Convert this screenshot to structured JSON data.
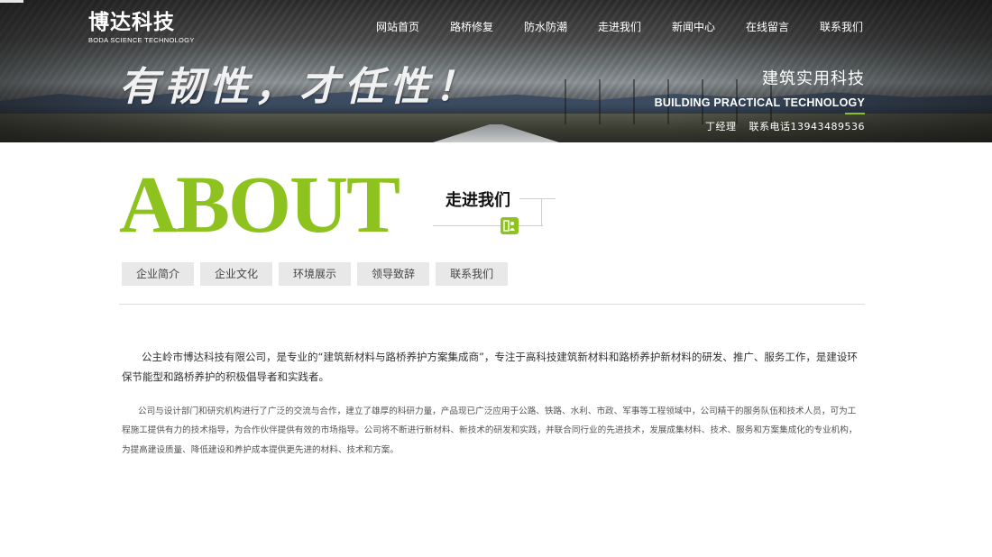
{
  "header": {
    "logo_cn": "博达科技",
    "logo_en": "BODA SCIENCE TECHNOLOGY",
    "nav": [
      {
        "label": "网站首页"
      },
      {
        "label": "路桥修复"
      },
      {
        "label": "防水防潮"
      },
      {
        "label": "走进我们"
      },
      {
        "label": "新闻中心"
      },
      {
        "label": "在线留言"
      },
      {
        "label": "联系我们"
      }
    ],
    "slogan": "有韧性，才任性！",
    "tagline_cn": "建筑实用科技",
    "tagline_en": "BUILDING PRACTICAL TECHNOLOGY",
    "contact_person": "丁经理",
    "contact_phone": "联系电话13943489536"
  },
  "about": {
    "big_title": "ABOUT",
    "cn_title": "走进我们",
    "tabs": [
      {
        "label": "企业简介"
      },
      {
        "label": "企业文化"
      },
      {
        "label": "环境展示"
      },
      {
        "label": "领导致辞"
      },
      {
        "label": "联系我们"
      }
    ],
    "para1": "公主岭市博达科技有限公司，是专业的“建筑新材料与路桥养护方案集成商”，专注于高科技建筑新材料和路桥养护新材料的研发、推广、服务工作，是建设环保节能型和路桥养护的积极倡导者和实践者。",
    "para2": "公司与设计部门和研究机构进行了广泛的交流与合作，建立了雄厚的科研力量，产品现已广泛应用于公路、铁路、水利、市政、军事等工程领域中，公司精干的服务队伍和技术人员，可为工程施工提供有力的技术指导，为合作伙伴提供有效的市场指导。公司将不断进行新材料、新技术的研发和实践，并联合同行业的先进技术，发展成集材料、技术、服务和方案集成化的专业机构，为提高建设质量、降低建设和养护成本提供更先进的材料、技术和方案。"
  },
  "colors": {
    "accent_green": "#8dc21f",
    "tab_bg": "#e8e8e8"
  }
}
